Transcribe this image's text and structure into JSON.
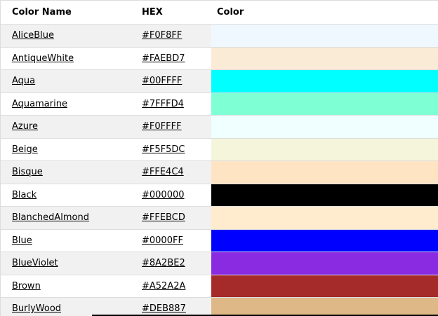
{
  "table": {
    "headers": {
      "name": "Color Name",
      "hex": "HEX",
      "color": "Color"
    },
    "rows": [
      {
        "name": "AliceBlue",
        "hex": "#F0F8FF",
        "swatch": "#F0F8FF"
      },
      {
        "name": "AntiqueWhite",
        "hex": "#FAEBD7",
        "swatch": "#FAEBD7"
      },
      {
        "name": "Aqua",
        "hex": "#00FFFF",
        "swatch": "#00FFFF"
      },
      {
        "name": "Aquamarine",
        "hex": "#7FFFD4",
        "swatch": "#7FFFD4"
      },
      {
        "name": "Azure",
        "hex": "#F0FFFF",
        "swatch": "#F0FFFF"
      },
      {
        "name": "Beige",
        "hex": "#F5F5DC",
        "swatch": "#F5F5DC"
      },
      {
        "name": "Bisque",
        "hex": "#FFE4C4",
        "swatch": "#FFE4C4"
      },
      {
        "name": "Black",
        "hex": "#000000",
        "swatch": "#000000"
      },
      {
        "name": "BlanchedAlmond",
        "hex": "#FFEBCD",
        "swatch": "#FFEBCD"
      },
      {
        "name": "Blue",
        "hex": "#0000FF",
        "swatch": "#0000FF"
      },
      {
        "name": "BlueViolet",
        "hex": "#8A2BE2",
        "swatch": "#8A2BE2"
      },
      {
        "name": "Brown",
        "hex": "#A52A2A",
        "swatch": "#A52A2A"
      },
      {
        "name": "BurlyWood",
        "hex": "#DEB887",
        "swatch": "#DEB887"
      }
    ]
  }
}
